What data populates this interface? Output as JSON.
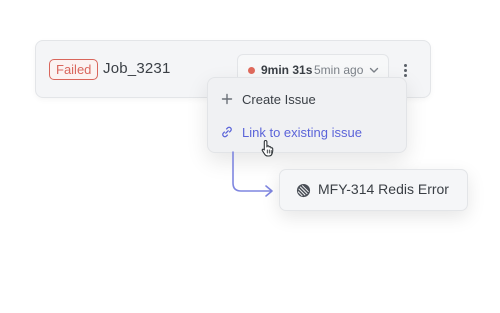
{
  "job": {
    "status": "Failed",
    "name": "Job_3231",
    "duration": "9min 31s",
    "time_ago": "5min ago"
  },
  "menu": {
    "items": [
      {
        "label": "Create Issue",
        "icon": "plus-icon"
      },
      {
        "label": "Link to existing issue",
        "icon": "link-icon"
      }
    ]
  },
  "linked_issue": {
    "label": "MFY-314 Redis Error",
    "icon": "linear-icon"
  },
  "colors": {
    "failed": "#d9665c",
    "link_accent": "#5b64d9",
    "connector": "#7f86e0"
  }
}
